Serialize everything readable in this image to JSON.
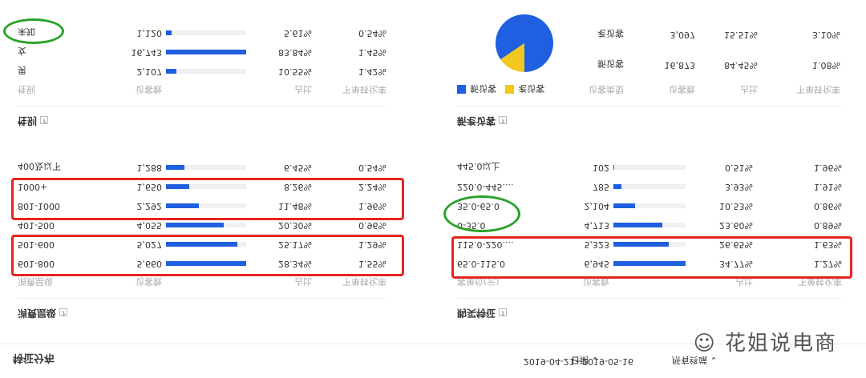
{
  "topbar": {
    "title": "特征分布",
    "terminal": "所有终端",
    "date_range": "2019-04-21~2019-05-16",
    "date_label": "日期"
  },
  "consumption": {
    "title": "消费层级",
    "headers": [
      "消费层级",
      "访客数",
      "占比",
      "下单转化率"
    ],
    "rows": [
      {
        "label": "601-800",
        "count": "5,660",
        "value": 5660,
        "ratio": "28.34%",
        "conv": "1.55%"
      },
      {
        "label": "501-600",
        "count": "5,027",
        "value": 5027,
        "ratio": "25.17%",
        "conv": "1.29%"
      },
      {
        "label": "401-500",
        "count": "4,055",
        "value": 4055,
        "ratio": "20.30%",
        "conv": "0.96%"
      },
      {
        "label": "801-1000",
        "count": "2,292",
        "value": 2292,
        "ratio": "11.48%",
        "conv": "1.96%"
      },
      {
        "label": "1000+",
        "count": "1,650",
        "value": 1650,
        "ratio": "8.26%",
        "conv": "2.24%"
      },
      {
        "label": "400及以下",
        "count": "1,288",
        "value": 1288,
        "ratio": "6.45%",
        "conv": "0.54%"
      }
    ]
  },
  "gender": {
    "title": "性别",
    "headers": [
      "性别",
      "访客数",
      "占比",
      "下单转化率"
    ],
    "rows": [
      {
        "label": "男",
        "count": "2,107",
        "value": 2107,
        "ratio": "10.55%",
        "conv": "1.42%"
      },
      {
        "label": "女",
        "count": "16,743",
        "value": 16743,
        "ratio": "83.84%",
        "conv": "1.45%"
      },
      {
        "label": "未知",
        "count": "1,120",
        "value": 1120,
        "ratio": "5.61%",
        "conv": "0.54%"
      }
    ]
  },
  "price": {
    "title": "购买特征",
    "headers": [
      "客单价(元)",
      "访客数",
      "占比",
      "下单转化率"
    ],
    "rows": [
      {
        "label": "65.0-115.0",
        "count": "6,945",
        "value": 6945,
        "ratio": "34.77%",
        "conv": "1.27%"
      },
      {
        "label": "115.0-220....",
        "count": "5,323",
        "value": 5323,
        "ratio": "26.65%",
        "conv": "1.63%"
      },
      {
        "label": "0-35.0",
        "count": "4,713",
        "value": 4713,
        "ratio": "23.60%",
        "conv": "0.89%"
      },
      {
        "label": "35.0-65.0",
        "count": "2,104",
        "value": 2104,
        "ratio": "10.53%",
        "conv": "0.86%"
      },
      {
        "label": "220.0-445....",
        "count": "785",
        "value": 785,
        "ratio": "3.93%",
        "conv": "1.91%"
      },
      {
        "label": "445.0以上",
        "count": "102",
        "value": 102,
        "ratio": "0.51%",
        "conv": "1.96%"
      }
    ]
  },
  "visitors": {
    "title": "新老访客",
    "headers": [
      "访客类型",
      "访客数",
      "占比",
      "下单转化率"
    ],
    "rows": [
      {
        "label": "新访客",
        "count": "16,873",
        "value": 16873,
        "ratio": "84.45%",
        "conv": "1.08%"
      },
      {
        "label": "老访客",
        "count": "3,097",
        "value": 3097,
        "ratio": "15.51%",
        "conv": "3.10%"
      }
    ],
    "legend": [
      "新访客",
      "老访客"
    ],
    "colors": [
      "#1f5fe0",
      "#f2c81f"
    ]
  },
  "watermark": "花姐说电商"
}
